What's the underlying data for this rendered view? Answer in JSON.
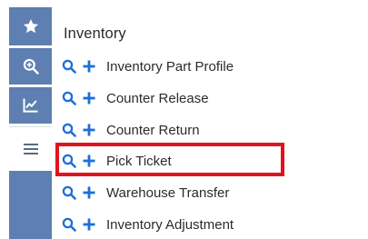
{
  "sidebar": {
    "buttons": [
      {
        "icon": "star-icon"
      },
      {
        "icon": "zoom-icon"
      },
      {
        "icon": "chart-icon"
      },
      {
        "icon": "menu-icon"
      }
    ],
    "accent_color": "#5d7fb1"
  },
  "panel": {
    "title": "Inventory",
    "items": [
      {
        "label": "Inventory Part Profile"
      },
      {
        "label": "Counter Release"
      },
      {
        "label": "Counter Return"
      },
      {
        "label": "Pick Ticket"
      },
      {
        "label": "Warehouse Transfer"
      },
      {
        "label": "Inventory Adjustment"
      }
    ]
  },
  "colors": {
    "icon_blue": "#1c6fd8",
    "highlight": "#e0141e"
  }
}
